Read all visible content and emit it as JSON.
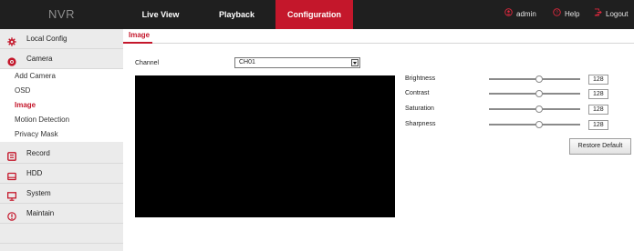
{
  "app": {
    "logo": "NVR"
  },
  "topnav": {
    "tabs": [
      {
        "label": "Live View"
      },
      {
        "label": "Playback"
      },
      {
        "label": "Configuration",
        "active": true
      }
    ],
    "user": "admin",
    "help": "Help",
    "logout": "Logout"
  },
  "sidebar": {
    "items": [
      {
        "label": "Local Config",
        "icon": "gear-icon"
      },
      {
        "label": "Camera",
        "icon": "camera-icon"
      },
      {
        "label": "Record",
        "icon": "record-icon"
      },
      {
        "label": "HDD",
        "icon": "hdd-icon"
      },
      {
        "label": "System",
        "icon": "monitor-icon"
      },
      {
        "label": "Maintain",
        "icon": "info-icon"
      }
    ],
    "camera_sub": [
      {
        "label": "Add Camera"
      },
      {
        "label": "OSD"
      },
      {
        "label": "Image",
        "active": true
      },
      {
        "label": "Motion Detection"
      },
      {
        "label": "Privacy Mask"
      }
    ]
  },
  "main": {
    "title": "Image",
    "channel_label": "Channel",
    "channel_value": "CH01",
    "params": [
      {
        "label": "Brightness",
        "value": "128"
      },
      {
        "label": "Contrast",
        "value": "128"
      },
      {
        "label": "Saturation",
        "value": "128"
      },
      {
        "label": "Sharpness",
        "value": "128"
      }
    ],
    "restore_label": "Restore Default"
  },
  "colors": {
    "accent": "#c4172b",
    "topbar": "#1f1f1f",
    "sidebar": "#ebebeb"
  }
}
